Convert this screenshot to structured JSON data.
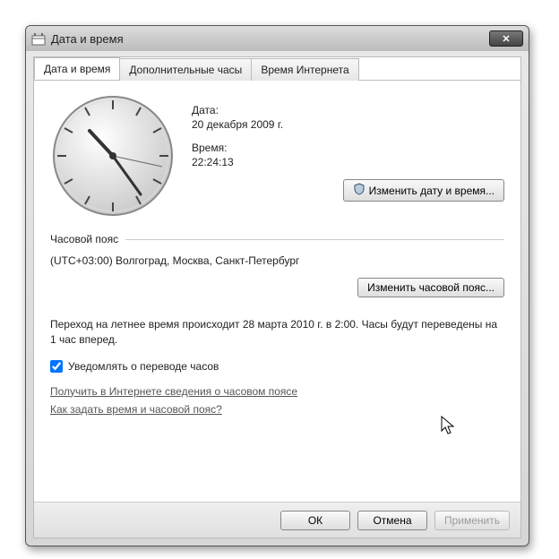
{
  "window": {
    "title": "Дата и время"
  },
  "tabs": [
    {
      "label": "Дата и время"
    },
    {
      "label": "Дополнительные часы"
    },
    {
      "label": "Время Интернета"
    }
  ],
  "date_section": {
    "date_label": "Дата:",
    "date_value": "20 декабря 2009 г.",
    "time_label": "Время:",
    "time_value": "22:24:13",
    "change_dt_button": "Изменить дату и время..."
  },
  "timezone_section": {
    "heading": "Часовой пояс",
    "tz_value": "(UTC+03:00) Волгоград, Москва, Санкт-Петербург",
    "change_tz_button": "Изменить часовой пояс..."
  },
  "dst": {
    "text": "Переход на летнее время происходит 28 марта 2010 г. в 2:00. Часы будут переведены на 1 час вперед.",
    "notify_label": "Уведомлять о переводе часов",
    "notify_checked": true
  },
  "links": {
    "link1": "Получить в Интернете сведения о часовом поясе",
    "link2": "Как задать время и часовой пояс?"
  },
  "footer": {
    "ok": "ОК",
    "cancel": "Отмена",
    "apply": "Применить"
  },
  "clock_display": {
    "hour": 22,
    "minute": 24,
    "second": 13
  }
}
